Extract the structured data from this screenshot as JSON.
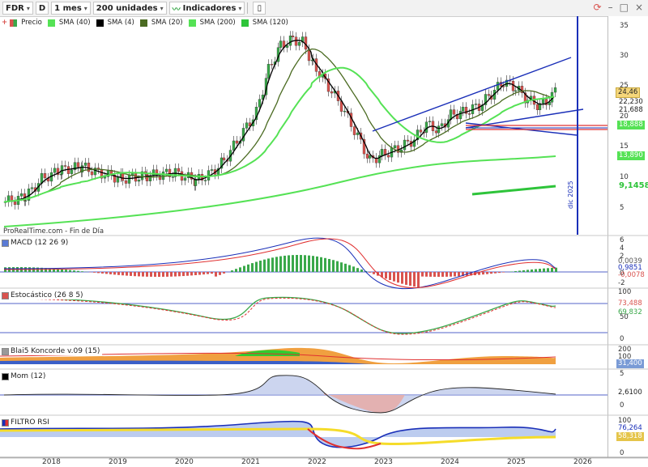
{
  "toolbar": {
    "ticker": "FDR",
    "d_button": "D",
    "period": "1 mes",
    "units": "200 unidades",
    "indicators": "Indicadores"
  },
  "price_legend": [
    "Precio",
    "SMA (40)",
    "SMA (4)",
    "SMA (20)",
    "SMA (200)",
    "SMA (120)"
  ],
  "watermark": "ProRealTime.com - Fin de Día",
  "vertical_marker": "dic 2025",
  "panels": {
    "macd": "MACD (12 26 9)",
    "stoch": "Estocástico (26 8 5)",
    "konc": "Blai5 Koncorde v.09 (15)",
    "mom": "Mom (12)",
    "rsi": "FILTRO RSI"
  },
  "price_axis": [
    "35",
    "30",
    "25",
    "20",
    "15",
    "10",
    "5"
  ],
  "price_tags": {
    "last": "24,46",
    "t1": "22,230",
    "t2": "21,688",
    "t3": "18,888",
    "t4": "13,890",
    "t5": "9,1458"
  },
  "macd_axis": [
    "6",
    "4",
    "2",
    "0",
    "-2"
  ],
  "macd_tags": [
    "0,0039",
    "0,9851",
    "-0,0078"
  ],
  "stoch_axis": [
    "100",
    "50",
    "0"
  ],
  "stoch_tags": [
    "73,488",
    "69,832"
  ],
  "konc_axis": [
    "200",
    "100",
    "0"
  ],
  "konc_tags": [
    "31,400"
  ],
  "mom_axis": [
    "5",
    "0"
  ],
  "mom_tags": [
    "2,6100"
  ],
  "rsi_axis": [
    "100",
    "50",
    "0"
  ],
  "rsi_tags": [
    "76,264",
    "58,318"
  ],
  "years": [
    "2018",
    "2019",
    "2020",
    "2021",
    "2022",
    "2023",
    "2024",
    "2025",
    "2026"
  ],
  "colors": {
    "up": "#3aa84a",
    "down": "#d9534f",
    "sma4": "#000000",
    "sma20": "#4b6b22",
    "sma40": "#55e255",
    "sma120": "#2ec43a",
    "trend": "#1a2fb8",
    "hline": "#e03030"
  }
}
